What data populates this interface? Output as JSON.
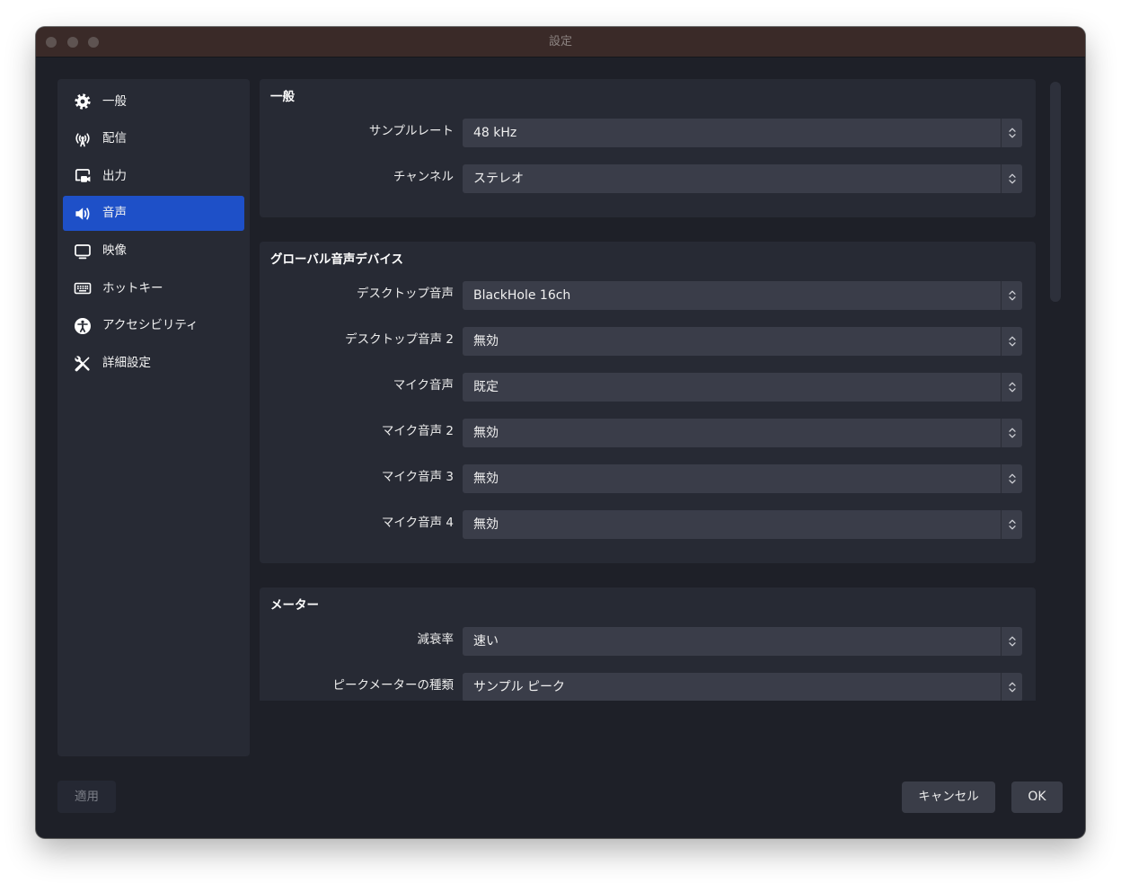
{
  "window": {
    "title": "設定"
  },
  "sidebar": {
    "items": [
      {
        "label": "一般",
        "icon": "gear-icon",
        "selected": false
      },
      {
        "label": "配信",
        "icon": "antenna-icon",
        "selected": false
      },
      {
        "label": "出力",
        "icon": "output-icon",
        "selected": false
      },
      {
        "label": "音声",
        "icon": "speaker-icon",
        "selected": true
      },
      {
        "label": "映像",
        "icon": "monitor-icon",
        "selected": false
      },
      {
        "label": "ホットキー",
        "icon": "keyboard-icon",
        "selected": false
      },
      {
        "label": "アクセシビリティ",
        "icon": "accessibility-icon",
        "selected": false
      },
      {
        "label": "詳細設定",
        "icon": "tools-icon",
        "selected": false
      }
    ]
  },
  "sections": [
    {
      "title": "一般",
      "rows": [
        {
          "label": "サンプルレート",
          "value": "48 kHz"
        },
        {
          "label": "チャンネル",
          "value": "ステレオ"
        }
      ]
    },
    {
      "title": "グローバル音声デバイス",
      "rows": [
        {
          "label": "デスクトップ音声",
          "value": "BlackHole 16ch"
        },
        {
          "label": "デスクトップ音声 2",
          "value": "無効"
        },
        {
          "label": "マイク音声",
          "value": "既定"
        },
        {
          "label": "マイク音声 2",
          "value": "無効"
        },
        {
          "label": "マイク音声 3",
          "value": "無効"
        },
        {
          "label": "マイク音声 4",
          "value": "無効"
        }
      ]
    },
    {
      "title": "メーター",
      "rows": [
        {
          "label": "減衰率",
          "value": "速い"
        },
        {
          "label": "ピークメーターの種類",
          "value": "サンプル ピーク"
        }
      ]
    }
  ],
  "footer": {
    "apply_label": "適用",
    "apply_enabled": false,
    "cancel_label": "キャンセル",
    "ok_label": "OK"
  },
  "colors": {
    "accent": "#1e50c8",
    "window_bg": "#1e2028",
    "panel_bg": "#272a34",
    "field_bg": "#3a3d49",
    "titlebar_bg": "#3a2a28"
  }
}
